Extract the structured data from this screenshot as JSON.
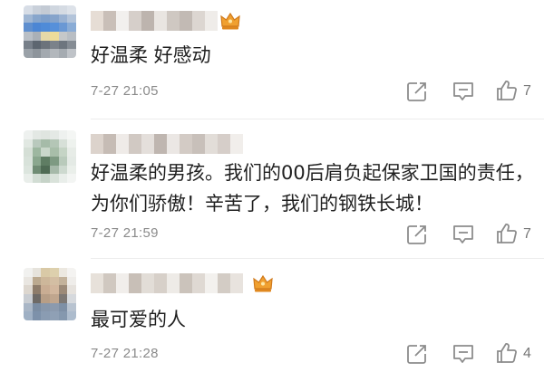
{
  "comments": [
    {
      "text": "好温柔 好感动",
      "time": "7-27 21:05",
      "likes": "7",
      "username_redacted": true,
      "has_crown_badge": true
    },
    {
      "text": "好温柔的男孩。我们的00后肩负起保家卫国的责任，为你们骄傲！辛苦了，我们的钢铁长城！",
      "time": "7-27 21:59",
      "likes": "7",
      "username_redacted": true,
      "has_crown_badge": false
    },
    {
      "text": "最可爱的人",
      "time": "7-27 21:28",
      "likes": "4",
      "username_redacted": true,
      "has_crown_badge": true
    }
  ],
  "icons": {
    "share": "share-icon",
    "comment": "comment-icon",
    "like": "thumbs-up-icon",
    "crown": "crown-badge-icon"
  },
  "colors": {
    "icon": "#8c8c8c",
    "time": "#8a8a8a",
    "crown": "#f0a030"
  }
}
